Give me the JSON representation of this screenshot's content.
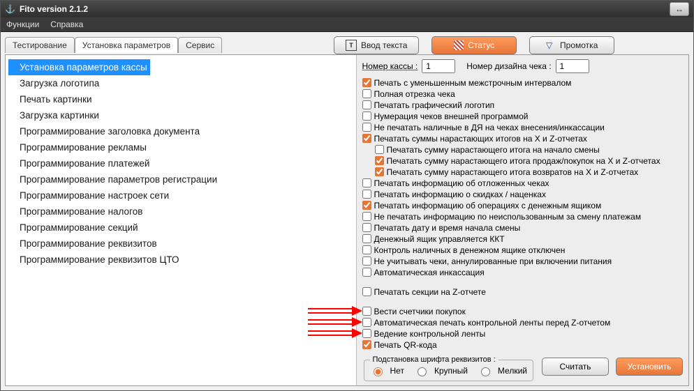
{
  "title": "Fito version 2.1.2",
  "menus": {
    "functions": "Функции",
    "help": "Справка"
  },
  "tabs": {
    "testing": "Тестирование",
    "params": "Установка параметров",
    "service": "Сервис"
  },
  "buttons": {
    "text_input": "Ввод текста",
    "status": "Статус",
    "feed": "Промотка",
    "read": "Считать",
    "set": "Установить"
  },
  "tree": [
    "Установка параметров кассы",
    "Загрузка логотипа",
    "Печать картинки",
    "Загрузка картинки",
    "Программирование заголовка документа",
    "Программирование рекламы",
    "Программирование платежей",
    "Программирование параметров регистрации",
    "Программирование настроек сети",
    "Программирование налогов",
    "Программирование секций",
    "Программирование реквизитов",
    "Программирование реквизитов ЦТО"
  ],
  "top_row": {
    "register_label": "Номер кассы :",
    "register_value": "1",
    "design_label": "Номер дизайна чека :",
    "design_value": "1"
  },
  "checks": [
    {
      "label": "Печать с уменьшенным межстрочным интервалом",
      "checked": true,
      "indent": 0
    },
    {
      "label": "Полная отрезка чека",
      "checked": false,
      "indent": 0
    },
    {
      "label": "Печатать графический логотип",
      "checked": false,
      "indent": 0
    },
    {
      "label": "Нумерация чеков внешней программой",
      "checked": false,
      "indent": 0
    },
    {
      "label": "Не печатать наличные в ДЯ на чеках внесения/инкассации",
      "checked": false,
      "indent": 0
    },
    {
      "label": "Печатать суммы нарастающих итогов на X и Z-отчетах",
      "checked": true,
      "indent": 0
    },
    {
      "label": "Печатать сумму нарастающего итога на начало смены",
      "checked": false,
      "indent": 1
    },
    {
      "label": "Печатать сумму нарастающего итога продаж/покупок на X и Z-отчетах",
      "checked": true,
      "indent": 1
    },
    {
      "label": "Печатать сумму нарастающего итога возвратов на X и Z-отчетах",
      "checked": true,
      "indent": 1
    },
    {
      "label": "Печатать информацию об отложенных чеках",
      "checked": false,
      "indent": 0
    },
    {
      "label": "Печатать информацию о скидках / наценках",
      "checked": false,
      "indent": 0
    },
    {
      "label": "Печатать информацию об операциях с денежным ящиком",
      "checked": true,
      "indent": 0
    },
    {
      "label": "Не печатать информацию по неиспользованным за смену платежам",
      "checked": false,
      "indent": 0
    },
    {
      "label": "Печатать дату и время начала смены",
      "checked": false,
      "indent": 0
    },
    {
      "label": "Денежный ящик управляется ККТ",
      "checked": false,
      "indent": 0
    },
    {
      "label": "Контроль наличных в денежном ящике отключен",
      "checked": false,
      "indent": 0
    },
    {
      "label": "Не учитывать чеки, аннулированные при включении питания",
      "checked": false,
      "indent": 0
    },
    {
      "label": "Автоматическая инкассация",
      "checked": false,
      "indent": 0
    },
    {
      "label": "Печатать секции на Z-отчете",
      "checked": false,
      "indent": 0,
      "gap_above": true
    },
    {
      "label": "Вести счетчики покупок",
      "checked": false,
      "indent": 0,
      "gap_above": true,
      "arrow": true
    },
    {
      "label": "Автоматическая печать контрольной ленты перед Z-отчетом",
      "checked": false,
      "indent": 0,
      "arrow": true
    },
    {
      "label": "Ведение контрольной ленты",
      "checked": false,
      "indent": 0,
      "arrow": true
    },
    {
      "label": "Печать QR-кода",
      "checked": true,
      "indent": 0
    }
  ],
  "font_box": {
    "legend": "Подстановка шрифта реквизитов :",
    "none": "Нет",
    "large": "Крупный",
    "small": "Мелкий"
  }
}
